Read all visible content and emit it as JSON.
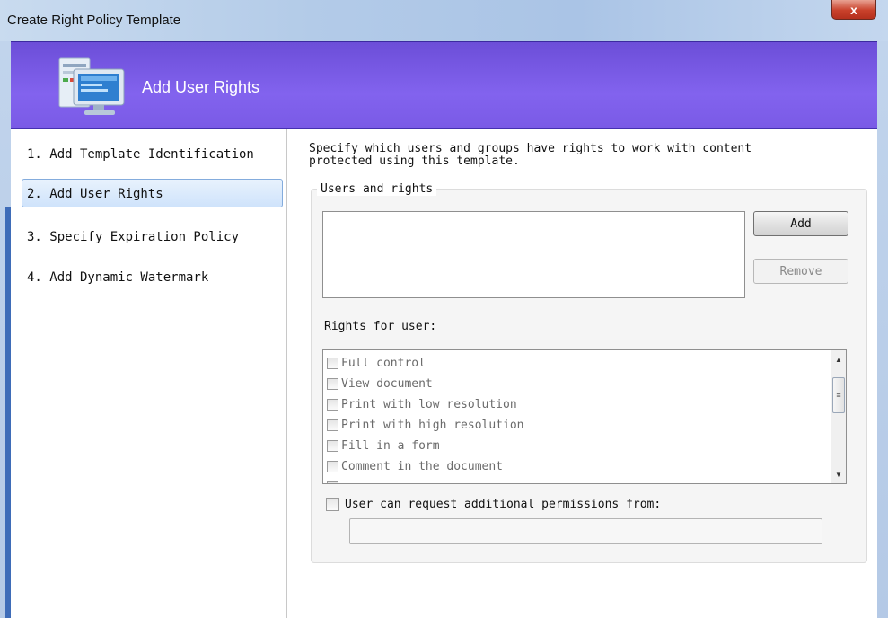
{
  "window": {
    "title": "Create Right Policy Template",
    "close_glyph": "x"
  },
  "banner": {
    "title": "Add User Rights",
    "icon": "computer-monitor-icon"
  },
  "nav": {
    "items": [
      {
        "label": "1. Add Template Identification",
        "selected": false
      },
      {
        "label": "2. Add User Rights",
        "selected": true
      },
      {
        "label": "3. Specify Expiration Policy",
        "selected": false
      },
      {
        "label": "4. Add Dynamic Watermark",
        "selected": false
      }
    ]
  },
  "content": {
    "description_line1": "Specify which users and groups have rights to work with content",
    "description_line2": "protected using this template.",
    "users_group": {
      "legend": "Users and rights",
      "add_label": "Add",
      "remove_label": "Remove"
    },
    "rights_label": "Rights for user:",
    "rights": [
      {
        "label": "Full control",
        "checked": false
      },
      {
        "label": "View document",
        "checked": false
      },
      {
        "label": "Print with low resolution",
        "checked": false
      },
      {
        "label": "Print with high resolution",
        "checked": false
      },
      {
        "label": "Fill in a form",
        "checked": false
      },
      {
        "label": "Comment in the document",
        "checked": false
      }
    ],
    "request_permissions_label": "User can request additional permissions from:",
    "request_permissions_value": ""
  },
  "colors": {
    "banner": "#7a5ae6",
    "selected_nav": "#cfe3fb",
    "close_button": "#c9412b"
  }
}
